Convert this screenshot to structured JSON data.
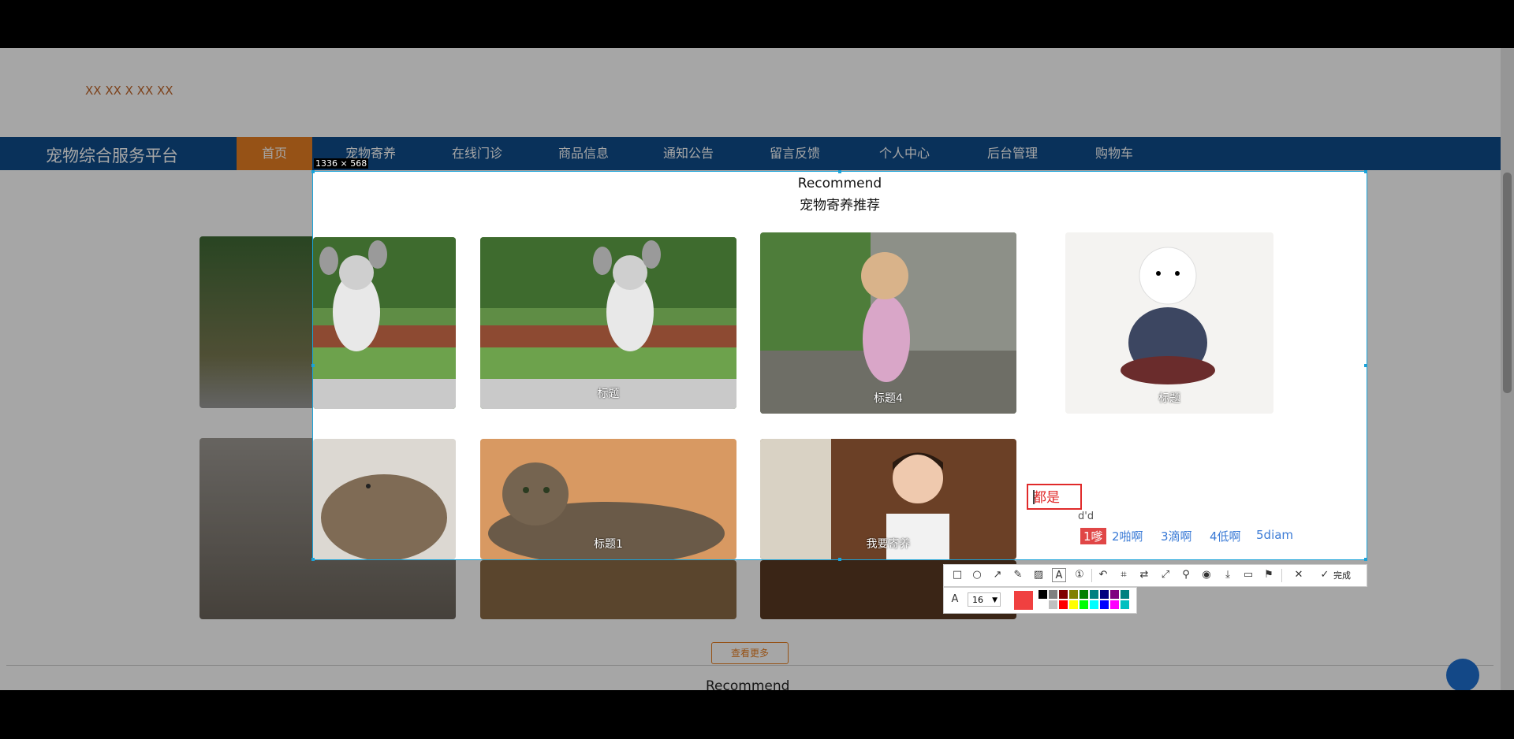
{
  "site": {
    "top_text": "XX XX X XX XX",
    "brand": "宠物综合服务平台",
    "nav": [
      {
        "label": "首页",
        "active": true
      },
      {
        "label": "宠物寄养"
      },
      {
        "label": "在线门诊"
      },
      {
        "label": "商品信息"
      },
      {
        "label": "通知公告"
      },
      {
        "label": "留言反馈"
      },
      {
        "label": "个人中心"
      },
      {
        "label": "后台管理"
      },
      {
        "label": "购物车"
      }
    ],
    "more_button": "查看更多",
    "recommend_heading": "Recommend"
  },
  "capture": {
    "size_label": "1336 × 568",
    "title": "Recommend",
    "subtitle": "宠物寄养推荐",
    "cards": [
      {
        "caption": "",
        "image": "running-dog-photo"
      },
      {
        "caption": "标题",
        "image": "running-dog-photo"
      },
      {
        "caption": "标题4",
        "image": "poodle-on-stones-photo"
      },
      {
        "caption": "标题",
        "image": "white-poodle-dress-photo"
      },
      {
        "caption": "",
        "image": "tabby-cat-photo"
      },
      {
        "caption": "标题1",
        "image": "tabby-cat-photo"
      },
      {
        "caption": "我要寄养",
        "image": "woman-portrait-photo"
      }
    ]
  },
  "annotation": {
    "text": "都是",
    "ime_code": "d'd",
    "ime_candidates": [
      "1嗲",
      "2啪啊",
      "3滴啊",
      "4低啊",
      "5diam"
    ]
  },
  "toolbar": {
    "tools": [
      "rectangle-icon",
      "ellipse-icon",
      "arrow-icon",
      "pencil-icon",
      "mosaic-icon",
      "text-icon",
      "serial-number-icon",
      "undo-icon",
      "ocr-icon",
      "translate-icon",
      "long-screenshot-icon",
      "pin-icon",
      "record-icon",
      "download-icon",
      "save-icon",
      "bookmark-icon",
      "close-icon",
      "check-icon"
    ],
    "done_label": "完成",
    "font_size": "16",
    "current_color": "#f04040",
    "palette_top": [
      "#000000",
      "#808080",
      "#800000",
      "#808000",
      "#008000",
      "#008080",
      "#000080",
      "#800080",
      "#008080"
    ],
    "palette_bottom": [
      "#ffffff",
      "#c0c0c0",
      "#ff0000",
      "#ffff00",
      "#00ff00",
      "#00ffff",
      "#0000ff",
      "#ff00ff",
      "#00c0c0"
    ]
  }
}
